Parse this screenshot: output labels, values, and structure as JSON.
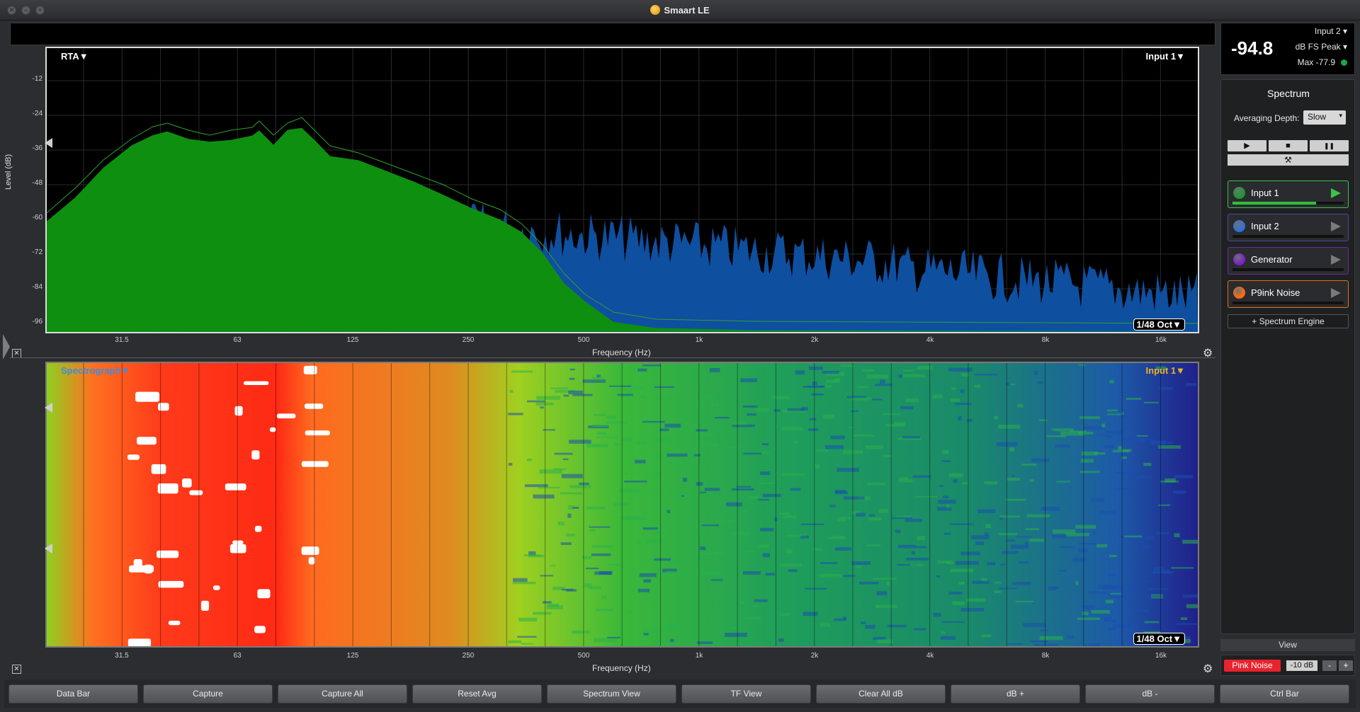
{
  "window": {
    "title": "Smaart LE"
  },
  "rta": {
    "mode_label": "RTA▼",
    "input_label": "Input 1▼",
    "resolution": "1/48 Oct▼",
    "y_axis_title": "Level (dB)",
    "x_axis_title": "Frequency (Hz)",
    "y_ticks": [
      "-12",
      "-24",
      "-36",
      "-48",
      "-60",
      "-72",
      "-84",
      "-96"
    ],
    "x_ticks": [
      "31.5",
      "63",
      "125",
      "250",
      "500",
      "1k",
      "2k",
      "4k",
      "8k",
      "16k"
    ]
  },
  "spectrograph": {
    "mode_label": "Spectrograph▼",
    "input_label": "Input 1▼",
    "resolution": "1/48 Oct▼",
    "x_axis_title": "Frequency (Hz)",
    "x_ticks": [
      "31.5",
      "63",
      "125",
      "250",
      "500",
      "1k",
      "2k",
      "4k",
      "8k",
      "16k"
    ]
  },
  "meter": {
    "value": "-94.8",
    "input": "Input 2",
    "unit": "dB FS Peak",
    "max": "Max -77.9",
    "max_indicator_color": "#1ea548"
  },
  "control": {
    "title": "Spectrum",
    "averaging_label": "Averaging Depth:",
    "averaging_value": "Slow",
    "transport": {
      "play_icon": "▶",
      "stop_icon": "■",
      "pause_icon": "❚❚"
    },
    "tools_icon": "⚒",
    "channels": [
      {
        "name": "Input 1",
        "color": "#1a9a2e",
        "border": "#3ec04a",
        "level": 0.75
      },
      {
        "name": "Input 2",
        "color": "#2f6fe0",
        "border": "#4a4a9a",
        "level": 0
      },
      {
        "name": "Generator",
        "color": "#7a1fd0",
        "border": "#6a2a9a",
        "level": 0
      },
      {
        "name": "P9ink Noise",
        "color": "#ff6a10",
        "border": "#e0701a",
        "level": 0
      }
    ],
    "add_engine": "+ Spectrum Engine"
  },
  "view_label": "View",
  "generator": {
    "button": "Pink Noise",
    "level": "-10 dB",
    "minus": "-",
    "plus": "+"
  },
  "bottom_buttons": [
    "Data Bar",
    "Capture",
    "Capture All",
    "Reset Avg",
    "Spectrum View",
    "TF View",
    "Clear All dB",
    "dB +",
    "dB -",
    "Ctrl Bar"
  ],
  "colors": {
    "ch1_trace": "#0f8f0f",
    "ch2_trace": "#0e4fa0",
    "accent_red": "#e8232d"
  }
}
